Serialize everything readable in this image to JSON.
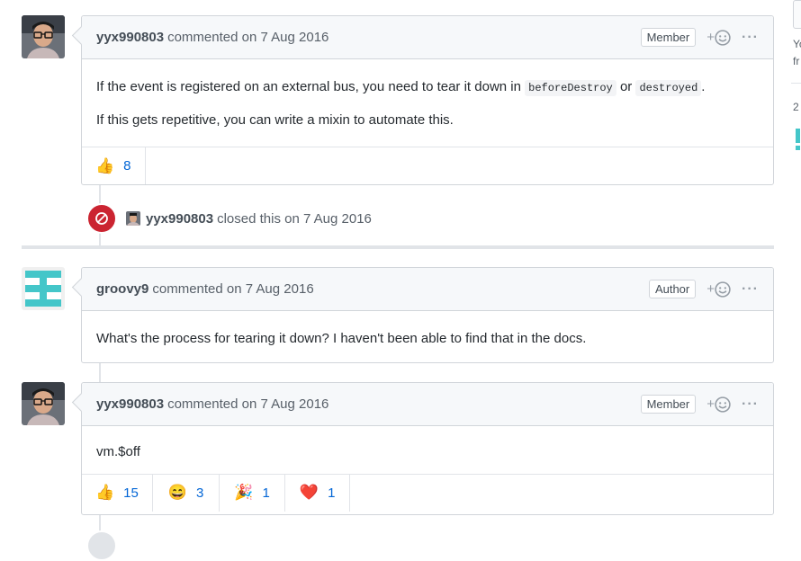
{
  "comments": [
    {
      "author": "yyx990803",
      "verb": "commented on 7 Aug 2016",
      "badge": "Member",
      "paragraphs": {
        "p1_before": "If the event is registered on an external bus, you need to tear it down in",
        "p1_code1": "beforeDestroy",
        "p1_or": "or",
        "p1_code2": "destroyed",
        "p1_end": ".",
        "p2": "If this gets repetitive, you can write a mixin to automate this."
      },
      "reactions": [
        {
          "emoji": "👍",
          "count": "8"
        }
      ]
    },
    {
      "author": "groovy9",
      "verb": "commented on 7 Aug 2016",
      "badge": "Author",
      "body": "What's the process for tearing it down? I haven't been able to find that in the docs."
    },
    {
      "author": "yyx990803",
      "verb": "commented on 7 Aug 2016",
      "badge": "Member",
      "body": "vm.$off",
      "reactions": [
        {
          "emoji": "👍",
          "count": "15"
        },
        {
          "emoji": "😄",
          "count": "3"
        },
        {
          "emoji": "🎉",
          "count": "1"
        },
        {
          "emoji": "❤️",
          "count": "1"
        }
      ]
    }
  ],
  "event": {
    "author": "yyx990803",
    "text": "closed this on 7 Aug 2016",
    "icon": "closed-circle-icon",
    "color": "#cb2431"
  },
  "sidebar_edge": {
    "line1": "Yo",
    "line2": "fr",
    "count": "2"
  },
  "colors": {
    "link": "#0366d6",
    "closed": "#cb2431",
    "identicon": "#44c6c9"
  }
}
